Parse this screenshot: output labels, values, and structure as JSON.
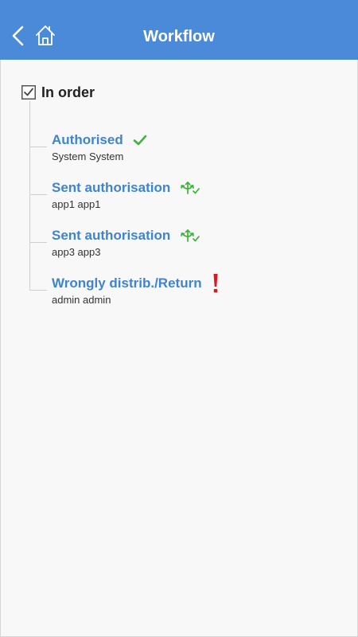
{
  "header": {
    "title": "Workflow",
    "background_color": "#4a8ad9",
    "back_icon": "chevron-left-icon",
    "home_icon": "home-icon"
  },
  "group": {
    "label": "In order",
    "checked": true
  },
  "steps": [
    {
      "title": "Authorised",
      "user": "System System",
      "status_icon": "checkmark-icon",
      "status_color": "#3db33d"
    },
    {
      "title": "Sent authorisation",
      "user": "app1 app1",
      "status_icon": "distribute-check-icon",
      "status_color": "#3db33d"
    },
    {
      "title": "Sent authorisation",
      "user": "app3 app3",
      "status_icon": "distribute-check-icon",
      "status_color": "#3db33d"
    },
    {
      "title": "Wrongly distrib./Return",
      "user": "admin admin",
      "status_icon": "exclamation-icon",
      "status_color": "#e3151a"
    }
  ],
  "colors": {
    "link": "#3e84d1",
    "tree_line": "#cfcfcf"
  }
}
